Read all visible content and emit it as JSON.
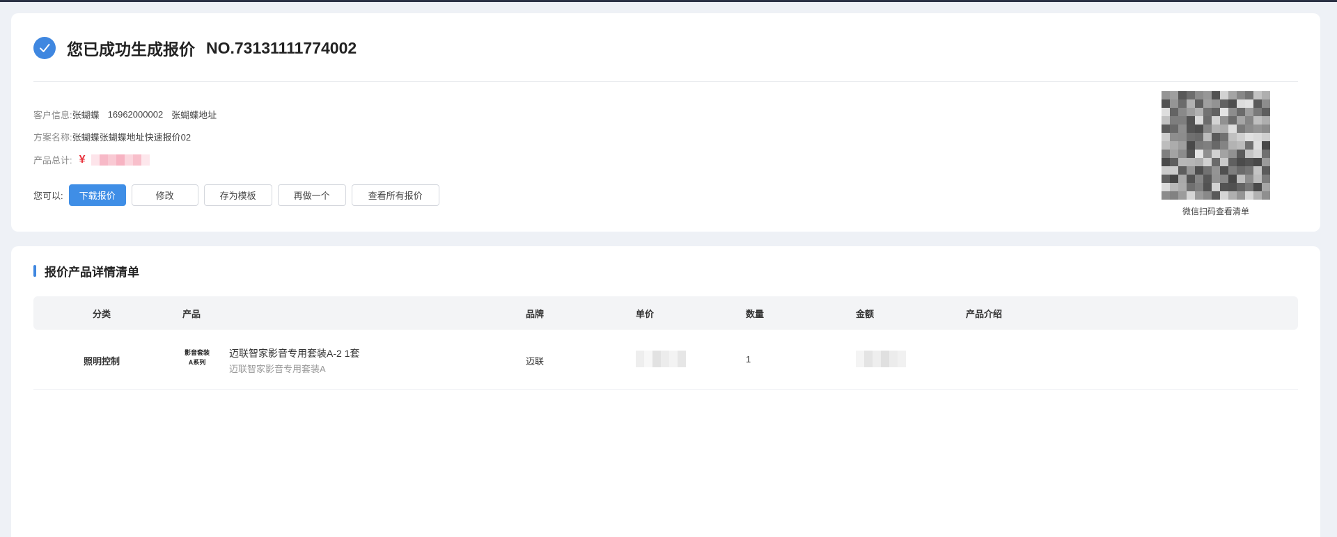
{
  "success": {
    "title": "您已成功生成报价",
    "quote_no": "NO.73131111774002",
    "customer_label": "客户信息:",
    "customer_name": "张蝴蝶",
    "customer_phone": "16962000002",
    "customer_address": "张蝴蝶地址",
    "plan_label": "方案名称:",
    "plan_name": "张蝴蝶张蝴蝶地址快速报价02",
    "total_label": "产品总计:",
    "currency_symbol": "¥",
    "actions_label": "您可以:",
    "buttons": {
      "download": "下载报价",
      "edit": "修改",
      "save_template": "存为模板",
      "redo": "再做一个",
      "view_all": "查看所有报价"
    },
    "qr_caption": "微信扫码查看清单"
  },
  "detail": {
    "section_title": "报价产品详情清单",
    "columns": {
      "category": "分类",
      "product": "产品",
      "brand": "品牌",
      "unit_price": "单价",
      "quantity": "数量",
      "amount": "金额",
      "intro": "产品介绍"
    },
    "rows": [
      {
        "category": "照明控制",
        "thumb_line1": "影音套装",
        "thumb_line2": "A系列",
        "name": "迈联智家影音专用套装A-2 1套",
        "subtitle": "迈联智家影音专用套装A",
        "brand": "迈联",
        "quantity": "1"
      }
    ]
  },
  "colors": {
    "accent": "#3f87e0",
    "primary_button": "#3f8ee6",
    "price_red": "#e8323c",
    "page_bg": "#eef1f6"
  },
  "icons": {
    "success": "check-circle-icon"
  }
}
